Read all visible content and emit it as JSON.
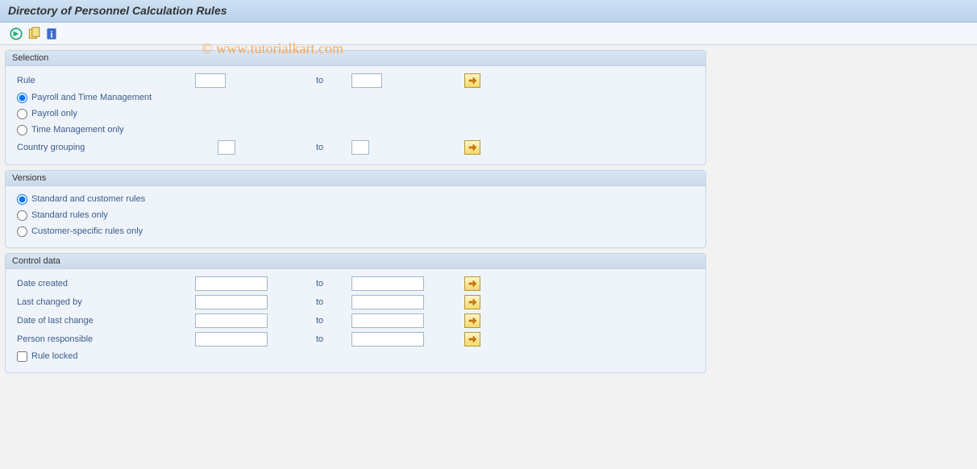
{
  "title": "Directory of Personnel Calculation Rules",
  "watermark": "© www.tutorialkart.com",
  "toolbar": {
    "execute": "Execute",
    "variant": "Get Variant",
    "info": "Information"
  },
  "selection": {
    "header": "Selection",
    "rule_label": "Rule",
    "rule_from": "",
    "rule_to": "",
    "to": "to",
    "opt1": "Payroll and Time Management",
    "opt2": "Payroll only",
    "opt3": "Time Management only",
    "cg_label": "Country grouping",
    "cg_from": "",
    "cg_to": ""
  },
  "versions": {
    "header": "Versions",
    "opt1": "Standard and customer rules",
    "opt2": "Standard rules only",
    "opt3": "Customer-specific rules only"
  },
  "control": {
    "header": "Control data",
    "to": "to",
    "date_created": "Date created",
    "date_created_from": "",
    "date_created_to": "",
    "last_changed_by": "Last changed by",
    "last_changed_by_from": "",
    "last_changed_by_to": "",
    "date_last_change": "Date of last change",
    "date_last_change_from": "",
    "date_last_change_to": "",
    "person_responsible": "Person responsible",
    "person_responsible_from": "",
    "person_responsible_to": "",
    "rule_locked": "Rule locked"
  }
}
